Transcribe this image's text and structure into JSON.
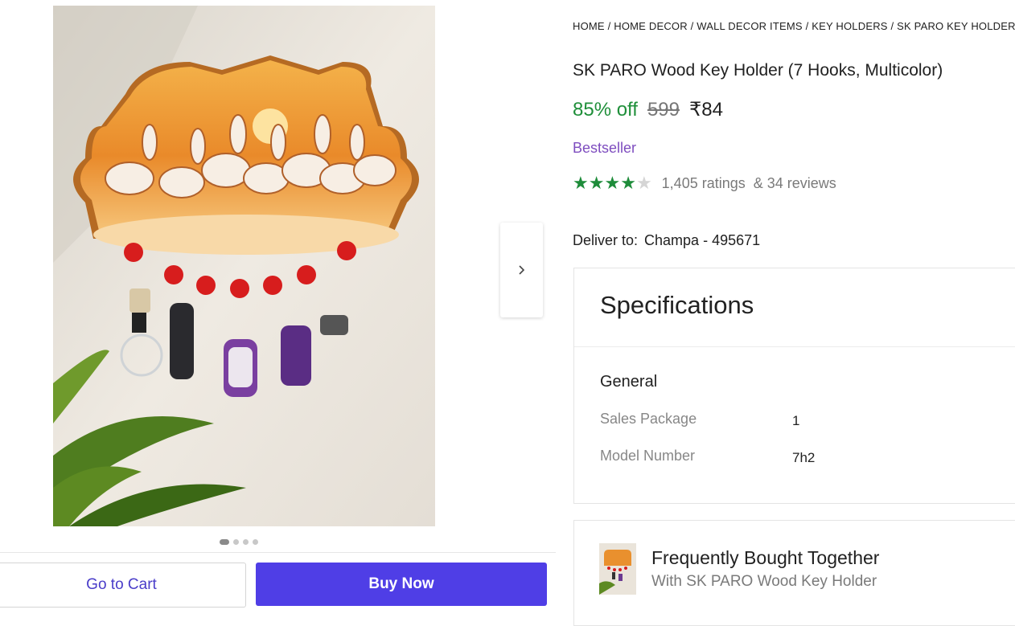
{
  "breadcrumb": [
    {
      "label": "HOME"
    },
    {
      "label": "HOME DECOR"
    },
    {
      "label": "WALL DECOR ITEMS"
    },
    {
      "label": "KEY HOLDERS"
    },
    {
      "label": "SK PARO KEY HOLDERS"
    }
  ],
  "breadcrumb_separator": " / ",
  "product": {
    "title": "SK PARO Wood Key Holder (7 Hooks, Multicolor)",
    "discount": "85% off",
    "mrp": "599",
    "price": "₹84",
    "badge": "Bestseller",
    "rating_value": 4,
    "rating_max": 5,
    "ratings_text": "1,405 ratings",
    "reviews_text": "& 34 reviews"
  },
  "gallery": {
    "image_icon": "product-photo",
    "slide_count": 4,
    "active_slide": 1,
    "next_icon": "chevron-right-icon"
  },
  "delivery": {
    "label": "Deliver to:",
    "location": "Champa - 495671"
  },
  "specifications": {
    "heading": "Specifications",
    "group": "General",
    "rows": [
      {
        "key": "Sales Package",
        "value": "1"
      },
      {
        "key": "Model Number",
        "value": "7h2"
      }
    ]
  },
  "fbt": {
    "title": "Frequently Bought Together",
    "subtitle": "With SK PARO Wood Key Holder"
  },
  "actions": {
    "cart_label": "Go to Cart",
    "buy_label": "Buy Now"
  },
  "colors": {
    "accent": "#4f3ee6",
    "discount": "#1f8f3a",
    "bestseller": "#7e4dbf",
    "star": "#1e8c3a"
  }
}
